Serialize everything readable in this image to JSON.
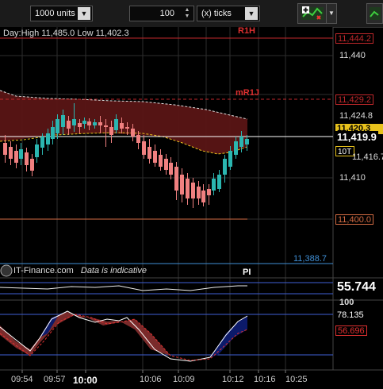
{
  "toolbar": {
    "units_value": "1000 units",
    "ticks_value": "100",
    "ticks_unit": "(x) ticks",
    "dropdown_arrow": "▼",
    "spin_up": "▲",
    "spin_down": "▼"
  },
  "chart": {
    "day_range_text": "Day:High 11,485.0 Low 11,402.3",
    "watermark_text": "IT-Finance.com",
    "disclaimer_text": "Data is indicative",
    "level_r1h": "R1H",
    "level_mr1j": "mR1J",
    "level_pi": "PI",
    "marker_10t": "10T",
    "price_levels": {
      "r1h": "11,444.2",
      "mr1j": "11,429.2",
      "last": "11,419.9",
      "upper_band": "11,424.8",
      "bid_partial": "11,420.3",
      "lower_band": "11,416.7",
      "support": "11,400.0",
      "pi": "11,388.7"
    },
    "price_axis": [
      "11,440",
      "11,420",
      "11,410"
    ],
    "time_axis": [
      "09:54",
      "09:57",
      "10:00",
      "10:06",
      "10:09",
      "10:12",
      "10:16",
      "10:25"
    ]
  },
  "indicators": {
    "rsi_value": "55.744",
    "stoch_top": "100",
    "stoch_k": "78.135",
    "stoch_d": "56.696"
  },
  "colors": {
    "up_candle": "#2bb6b0",
    "down_candle": "#f08080",
    "r1_line": "#c0282b",
    "support_line": "#d26b43",
    "pi_line": "#3f8fd6",
    "cloud": "#5a1515",
    "ma_yellow": "#e8c21c"
  }
}
